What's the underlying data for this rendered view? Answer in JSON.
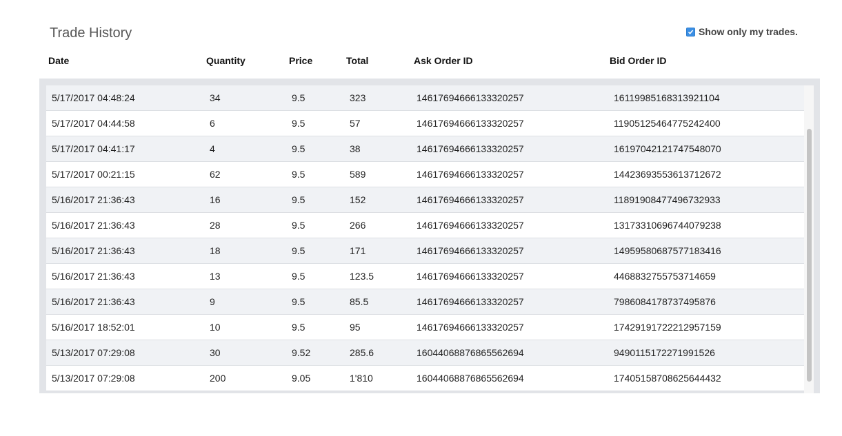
{
  "title": "Trade History",
  "filter": {
    "label": "Show only my trades.",
    "checked": true
  },
  "columns": {
    "date": "Date",
    "quantity": "Quantity",
    "price": "Price",
    "total": "Total",
    "ask": "Ask Order ID",
    "bid": "Bid Order ID"
  },
  "rows": [
    {
      "date": "5/17/2017 04:48:24",
      "quantity": "34",
      "price": "9.5",
      "total": "323",
      "ask": "14617694666133320257",
      "bid": "16119985168313921104"
    },
    {
      "date": "5/17/2017 04:44:58",
      "quantity": "6",
      "price": "9.5",
      "total": "57",
      "ask": "14617694666133320257",
      "bid": "11905125464775242400"
    },
    {
      "date": "5/17/2017 04:41:17",
      "quantity": "4",
      "price": "9.5",
      "total": "38",
      "ask": "14617694666133320257",
      "bid": "16197042121747548070"
    },
    {
      "date": "5/17/2017 00:21:15",
      "quantity": "62",
      "price": "9.5",
      "total": "589",
      "ask": "14617694666133320257",
      "bid": "14423693553613712672"
    },
    {
      "date": "5/16/2017 21:36:43",
      "quantity": "16",
      "price": "9.5",
      "total": "152",
      "ask": "14617694666133320257",
      "bid": "11891908477496732933"
    },
    {
      "date": "5/16/2017 21:36:43",
      "quantity": "28",
      "price": "9.5",
      "total": "266",
      "ask": "14617694666133320257",
      "bid": "13173310696744079238"
    },
    {
      "date": "5/16/2017 21:36:43",
      "quantity": "18",
      "price": "9.5",
      "total": "171",
      "ask": "14617694666133320257",
      "bid": "14959580687577183416"
    },
    {
      "date": "5/16/2017 21:36:43",
      "quantity": "13",
      "price": "9.5",
      "total": "123.5",
      "ask": "14617694666133320257",
      "bid": "4468832755753714659"
    },
    {
      "date": "5/16/2017 21:36:43",
      "quantity": "9",
      "price": "9.5",
      "total": "85.5",
      "ask": "14617694666133320257",
      "bid": "7986084178737495876"
    },
    {
      "date": "5/16/2017 18:52:01",
      "quantity": "10",
      "price": "9.5",
      "total": "95",
      "ask": "14617694666133320257",
      "bid": "17429191722212957159"
    },
    {
      "date": "5/13/2017 07:29:08",
      "quantity": "30",
      "price": "9.52",
      "total": "285.6",
      "ask": "16044068876865562694",
      "bid": "9490115172271991526"
    },
    {
      "date": "5/13/2017 07:29:08",
      "quantity": "200",
      "price": "9.05",
      "total": "1'810",
      "ask": "16044068876865562694",
      "bid": "17405158708625644432"
    }
  ]
}
